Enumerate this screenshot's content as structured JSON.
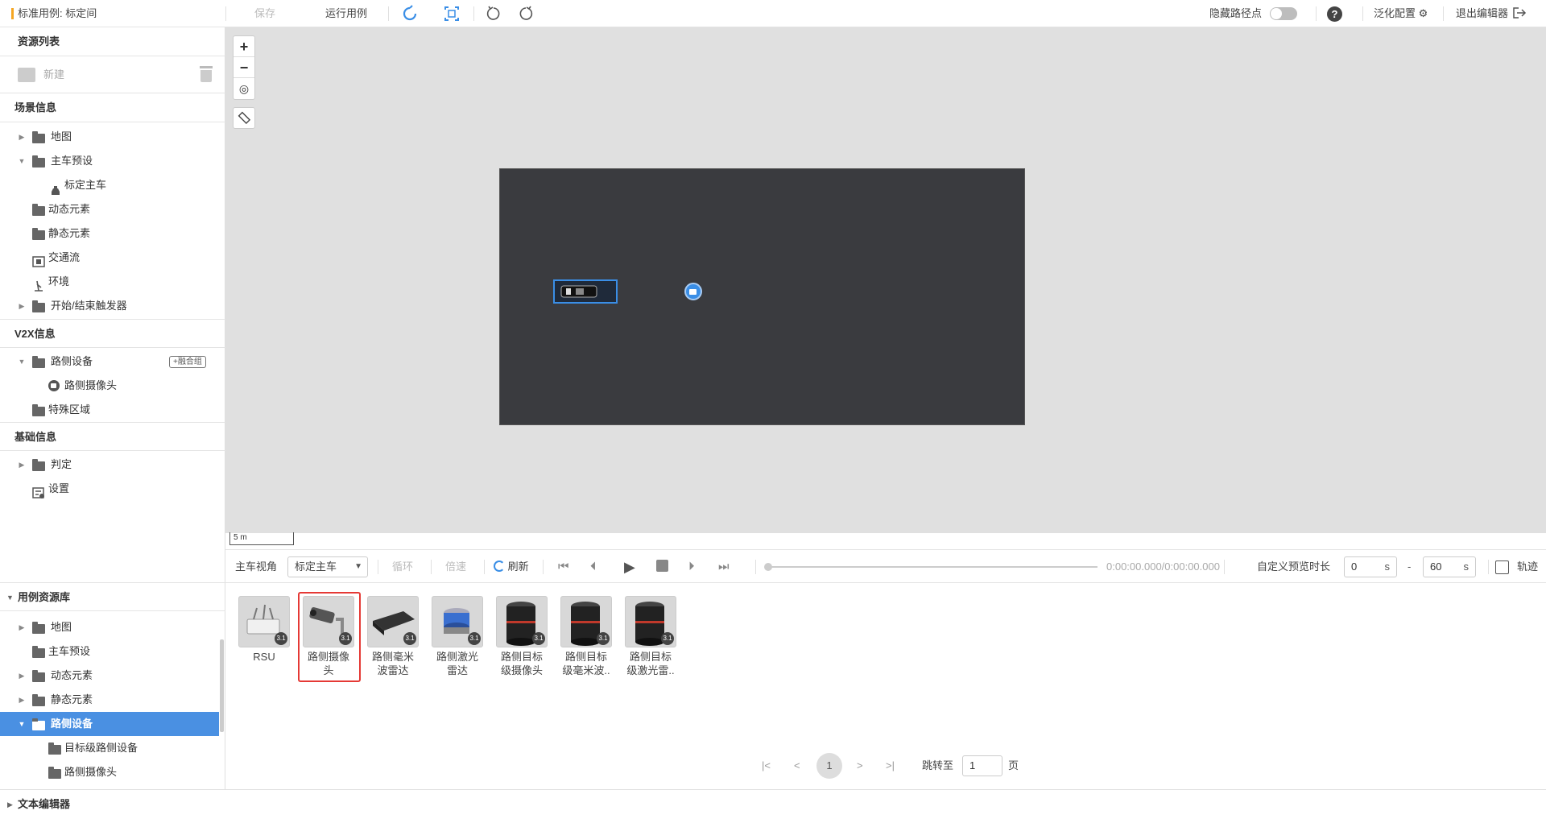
{
  "topbar": {
    "title": "标准用例: 标定间",
    "save": "保存",
    "run": "运行用例",
    "hide_waypoints": "隐藏路径点",
    "generalize": "泛化配置",
    "exit": "退出编辑器"
  },
  "sidebar": {
    "resources_title": "资源列表",
    "new": "新建",
    "scene_info": "场景信息",
    "scene_items": [
      {
        "label": "地图"
      },
      {
        "label": "主车预设"
      },
      {
        "label": "标定主车"
      },
      {
        "label": "动态元素"
      },
      {
        "label": "静态元素"
      },
      {
        "label": "交通流"
      },
      {
        "label": "环境"
      },
      {
        "label": "开始/结束触发器"
      }
    ],
    "v2x_info": "V2X信息",
    "v2x_items": [
      {
        "label": "路侧设备"
      },
      {
        "label": "路侧摄像头"
      },
      {
        "label": "特殊区域"
      }
    ],
    "fusion_group": "+融合组",
    "base_info": "基础信息",
    "base_items": [
      {
        "label": "判定"
      },
      {
        "label": "设置"
      }
    ],
    "case_lib_title": "用例资源库",
    "case_lib_items": [
      {
        "label": "地图"
      },
      {
        "label": "主车预设"
      },
      {
        "label": "动态元素"
      },
      {
        "label": "静态元素"
      },
      {
        "label": "路侧设备"
      },
      {
        "label": "目标级路侧设备"
      },
      {
        "label": "路侧摄像头"
      }
    ]
  },
  "canvas": {
    "scale_label": "5 m"
  },
  "playbar": {
    "view_label": "主车视角",
    "view_select": "标定主车",
    "loop": "循环",
    "speed": "倍速",
    "refresh": "刷新",
    "time": "0:00:00.000/0:00:00.000",
    "custom_preview": "自定义预览时长",
    "start_value": "0",
    "end_value": "60",
    "unit_s": "s",
    "dash": "-",
    "track": "轨迹"
  },
  "library": {
    "items": [
      {
        "name": "RSU"
      },
      {
        "name": "路侧摄像头"
      },
      {
        "name": "路侧毫米波雷达"
      },
      {
        "name": "路侧激光雷达"
      },
      {
        "name": "路侧目标级摄像头"
      },
      {
        "name": "路侧目标级毫米波.."
      },
      {
        "name": "路侧目标级激光雷.."
      }
    ],
    "badge": "3.1",
    "selected_index": 1
  },
  "pager": {
    "current": "1",
    "goto_label": "跳转至",
    "goto_value": "1",
    "page_unit": "页"
  },
  "bottom": {
    "text_editor": "文本编辑器"
  },
  "colors": {
    "accent": "#3a8ee6",
    "selected_bg": "#4a90e2",
    "highlight_border": "#e53935",
    "title_marker": "#f5a623"
  }
}
